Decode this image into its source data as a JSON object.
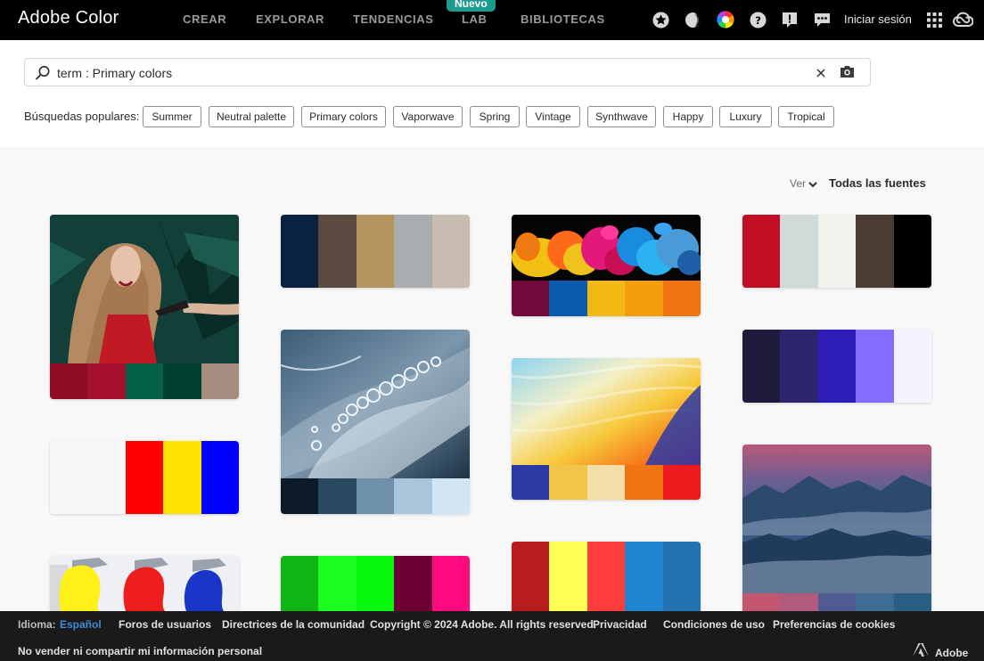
{
  "nav": {
    "brand": "Adobe Color",
    "links": [
      "CREAR",
      "EXPLORAR",
      "TENDENCIAS",
      "LAB",
      "BIBLIOTECAS"
    ],
    "badge": "Nuevo",
    "signin": "Iniciar sesión"
  },
  "search": {
    "value": "term : Primary colors",
    "popular_label": "Búsquedas populares:",
    "chips": [
      "Summer",
      "Neutral palette",
      "Primary colors",
      "Vaporwave",
      "Spring",
      "Vintage",
      "Synthwave",
      "Happy",
      "Luxury",
      "Tropical"
    ]
  },
  "sort": {
    "label": "Ver",
    "value": "Todas las fuentes"
  },
  "cards": [
    {
      "kind": "photo-portrait",
      "colors": [
        "#8f0d22",
        "#a5102e",
        "#046148",
        "#033f30",
        "#a58e80"
      ]
    },
    {
      "kind": "swatch",
      "colors": [
        "#0b2140",
        "#5b4a40",
        "#b3945f",
        "#a8adb0",
        "#c7bcaf"
      ]
    },
    {
      "kind": "photo-powder",
      "colors": [
        "#730a3d",
        "#0c5cad",
        "#f3b912",
        "#f39d0c",
        "#f07412"
      ]
    },
    {
      "kind": "swatch",
      "colors": [
        "#c10e24",
        "#d1d9d9",
        "#f2f2ed",
        "#4a3b33",
        "#000000"
      ]
    },
    {
      "kind": "photo-bubbles",
      "colors": [
        "#0d1b28",
        "#284960",
        "#6e90a8",
        "#a9c5d9",
        "#d2e5f2"
      ]
    },
    {
      "kind": "swatch",
      "colors": [
        "#1e1a3c",
        "#2e2570",
        "#2e1cbb",
        "#846cff",
        "#f5f3ff"
      ]
    },
    {
      "kind": "photo-gradient",
      "colors": [
        "#2c3aa6",
        "#f2c44a",
        "#f2dfa8",
        "#f27312",
        "#ee1c1c"
      ]
    },
    {
      "kind": "swatch",
      "colors": [
        "#f7f7f8",
        "#f7f7f8",
        "#ff0000",
        "#ffe300",
        "#0000ff"
      ]
    },
    {
      "kind": "photo-mountains",
      "colors": [
        "#c35770",
        "#b05a7c",
        "#4f5b91",
        "#3f6c95",
        "#2a5d82"
      ]
    },
    {
      "kind": "photo-paint",
      "colors": []
    },
    {
      "kind": "swatch",
      "colors": [
        "#0eb515",
        "#1aff1f",
        "#06f90a",
        "#6c0034",
        "#ff0a7f"
      ]
    },
    {
      "kind": "swatch",
      "colors": [
        "#b71d1d",
        "#ffff55",
        "#ff3d3d",
        "#1f85cf",
        "#2373b0"
      ]
    }
  ],
  "footer": {
    "lang_label": "Idioma:",
    "lang_value": "Español",
    "links": [
      "Foros de usuarios",
      "Directrices de la comunidad",
      "Copyright © 2024 Adobe. All rights reserved.",
      "Privacidad",
      "Condiciones de uso",
      "Preferencias de cookies"
    ],
    "donotsell": "No vender ni compartir mi información personal",
    "adobe": "Adobe"
  },
  "icons": [
    "star-icon",
    "contrast-icon",
    "color-wheel-icon",
    "help-icon",
    "feedback-icon",
    "chat-icon",
    "apps-grid-icon",
    "creative-cloud-icon",
    "search-icon",
    "clear-icon",
    "camera-icon",
    "chevron-down-icon",
    "adobe-logo-icon"
  ]
}
